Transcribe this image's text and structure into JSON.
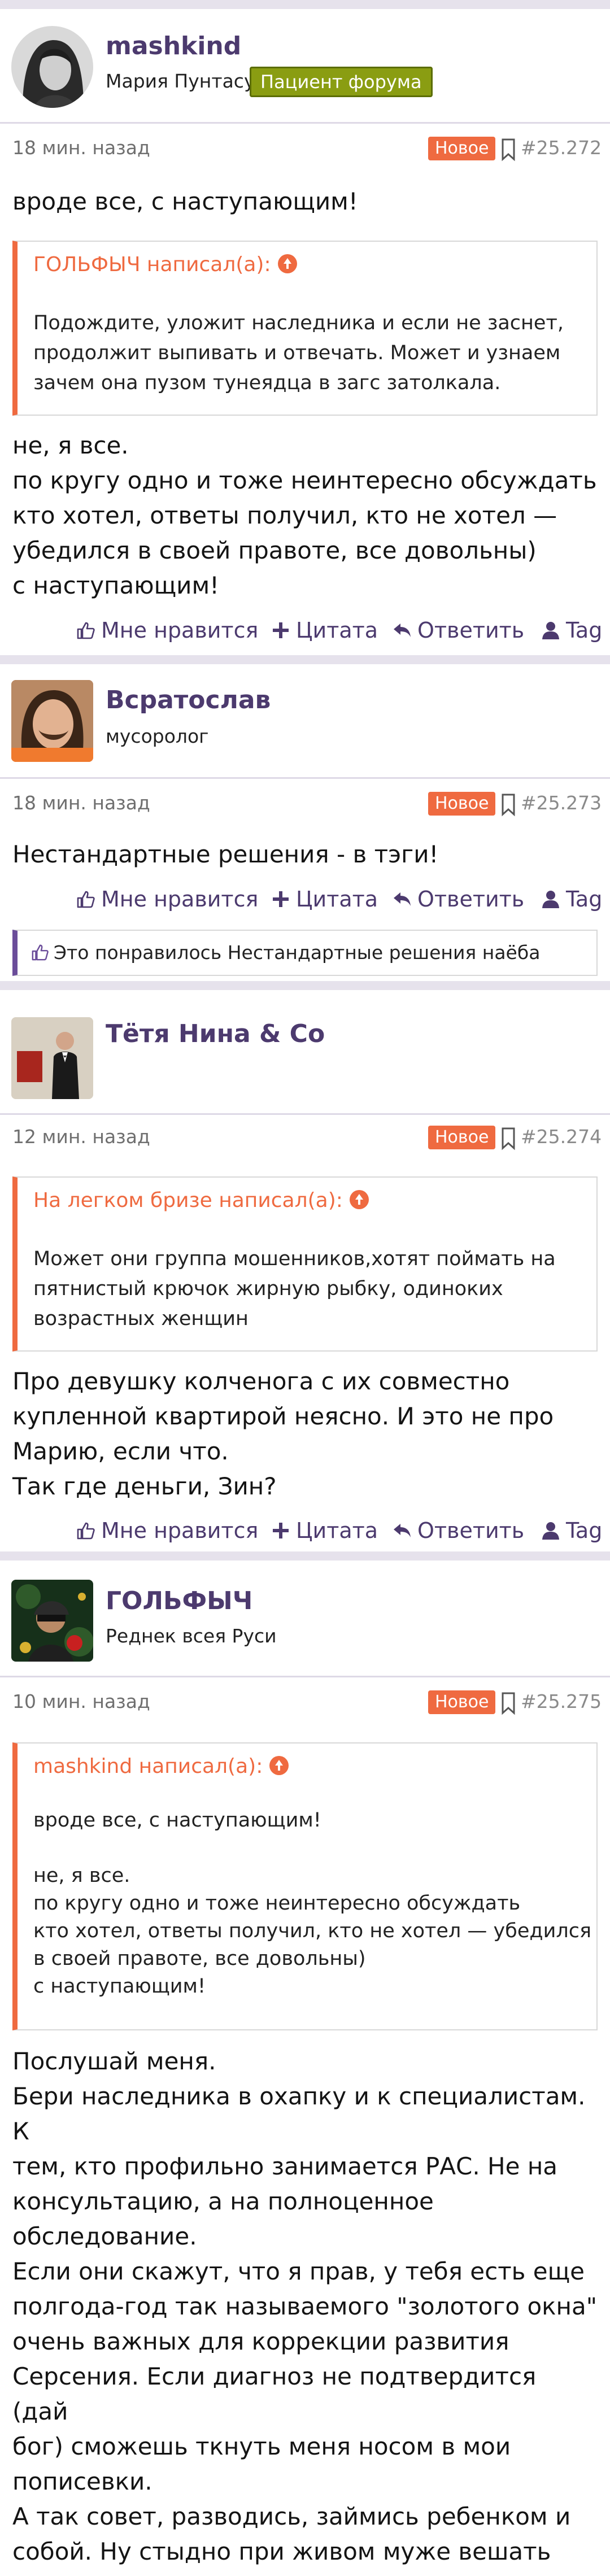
{
  "actions": {
    "like": "Мне нравится",
    "quote": "Цитата",
    "reply": "Ответить",
    "tag": "Tag"
  },
  "new_label": "Новое",
  "colors": {
    "accent": "#4c3a6e",
    "new": "#ef6a40",
    "badge": "#8a9d12"
  },
  "posts": [
    {
      "username": "mashkind",
      "user_title": "Мария Пунтасу",
      "badge": "Пациент форума",
      "time": "18 мин. назад",
      "number": "#25.272",
      "before_quote": "вроде все, с наступающим!",
      "quote_author": "ГОЛЬФЫЧ написал(а):",
      "quote_text": "Подождите, уложит наследника и если не заснет,\nпродолжит выпивать и отвечать. Может и узнаем\nзачем она пузом тунеядца в загс затолкала.",
      "after_quote": "не, я все.\nпо кругу одно и тоже неинтересно обсуждать\nкто хотел, ответы получил, кто не хотел —\nубедился в своей правоте, все довольны)\nс наступающим!"
    },
    {
      "username": "Всратослав",
      "user_title": "мусоролог",
      "time": "18 мин. назад",
      "number": "#25.273",
      "text": "Нестандартные решения - в тэги!",
      "liked_by": "Это понравилось Нестандартные решения наёба"
    },
    {
      "username": "Тётя Нина & Co",
      "time": "12 мин. назад",
      "number": "#25.274",
      "quote_author": "На легком бризе написал(а):",
      "quote_text": "Может они группа мошенников,хотят поймать на\nпятнистый крючок жирную рыбку, одиноких\nвозрастных женщин",
      "after_quote": "Про девушку колченога с их совместно\nкупленной квартирой неясно. И это не про\nМарию, если что.\nТак где деньги, Зин?"
    },
    {
      "username": "ГОЛЬФЫЧ",
      "user_title": "Реднек всея Руси",
      "time": "10 мин. назад",
      "number": "#25.275",
      "quote_author": "mashkind написал(а):",
      "quote_text": "вроде все, с наступающим!\n\nне, я все.\nпо кругу одно и тоже неинтересно обсуждать\nкто хотел, ответы получил, кто не хотел — убедился\nв своей правоте, все довольны)\nс наступающим!",
      "after_quote": "Послушай меня.\nБери наследника в охапку и к специалистам. К\nтем, кто профильно занимается РАС. Не на\nконсультацию, а на полноценное обследование.\nЕсли они скажут, что я прав, у тебя есть еще\nполгода-год так называемого \"золотого окна\"\nочень важных для коррекции развития\nСерсения. Если диагноз не подтвердится (дай\nбог) сможешь ткнуть меня носом в мои\nпописевки.\nА так совет, разводись, займись ребенком и\nсобой. Ну стыдно при живом муже вешать себя\nс ребенком на старых родителей.\nИ извинись перед россиянами."
    }
  ]
}
